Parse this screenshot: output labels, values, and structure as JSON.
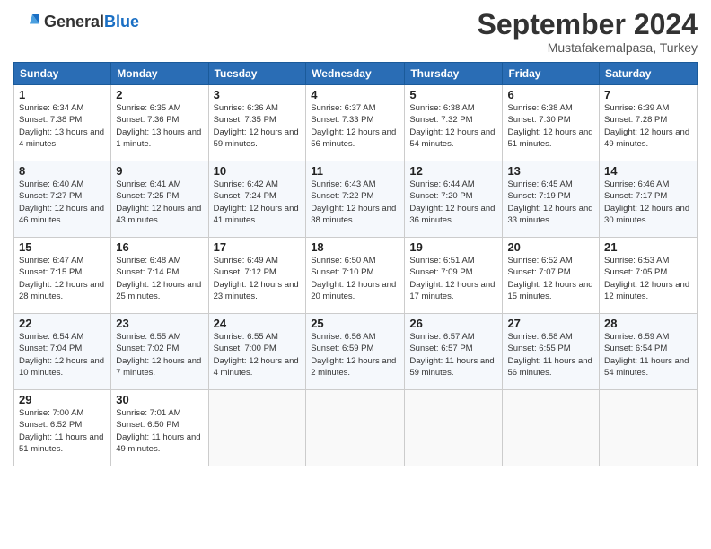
{
  "header": {
    "logo_general": "General",
    "logo_blue": "Blue",
    "month_title": "September 2024",
    "location": "Mustafakemalpasa, Turkey"
  },
  "weekdays": [
    "Sunday",
    "Monday",
    "Tuesday",
    "Wednesday",
    "Thursday",
    "Friday",
    "Saturday"
  ],
  "days": [
    {
      "day": "1",
      "sunrise": "6:34 AM",
      "sunset": "7:38 PM",
      "daylight": "13 hours and 4 minutes"
    },
    {
      "day": "2",
      "sunrise": "6:35 AM",
      "sunset": "7:36 PM",
      "daylight": "13 hours and 1 minute"
    },
    {
      "day": "3",
      "sunrise": "6:36 AM",
      "sunset": "7:35 PM",
      "daylight": "12 hours and 59 minutes"
    },
    {
      "day": "4",
      "sunrise": "6:37 AM",
      "sunset": "7:33 PM",
      "daylight": "12 hours and 56 minutes"
    },
    {
      "day": "5",
      "sunrise": "6:38 AM",
      "sunset": "7:32 PM",
      "daylight": "12 hours and 54 minutes"
    },
    {
      "day": "6",
      "sunrise": "6:38 AM",
      "sunset": "7:30 PM",
      "daylight": "12 hours and 51 minutes"
    },
    {
      "day": "7",
      "sunrise": "6:39 AM",
      "sunset": "7:28 PM",
      "daylight": "12 hours and 49 minutes"
    },
    {
      "day": "8",
      "sunrise": "6:40 AM",
      "sunset": "7:27 PM",
      "daylight": "12 hours and 46 minutes"
    },
    {
      "day": "9",
      "sunrise": "6:41 AM",
      "sunset": "7:25 PM",
      "daylight": "12 hours and 43 minutes"
    },
    {
      "day": "10",
      "sunrise": "6:42 AM",
      "sunset": "7:24 PM",
      "daylight": "12 hours and 41 minutes"
    },
    {
      "day": "11",
      "sunrise": "6:43 AM",
      "sunset": "7:22 PM",
      "daylight": "12 hours and 38 minutes"
    },
    {
      "day": "12",
      "sunrise": "6:44 AM",
      "sunset": "7:20 PM",
      "daylight": "12 hours and 36 minutes"
    },
    {
      "day": "13",
      "sunrise": "6:45 AM",
      "sunset": "7:19 PM",
      "daylight": "12 hours and 33 minutes"
    },
    {
      "day": "14",
      "sunrise": "6:46 AM",
      "sunset": "7:17 PM",
      "daylight": "12 hours and 30 minutes"
    },
    {
      "day": "15",
      "sunrise": "6:47 AM",
      "sunset": "7:15 PM",
      "daylight": "12 hours and 28 minutes"
    },
    {
      "day": "16",
      "sunrise": "6:48 AM",
      "sunset": "7:14 PM",
      "daylight": "12 hours and 25 minutes"
    },
    {
      "day": "17",
      "sunrise": "6:49 AM",
      "sunset": "7:12 PM",
      "daylight": "12 hours and 23 minutes"
    },
    {
      "day": "18",
      "sunrise": "6:50 AM",
      "sunset": "7:10 PM",
      "daylight": "12 hours and 20 minutes"
    },
    {
      "day": "19",
      "sunrise": "6:51 AM",
      "sunset": "7:09 PM",
      "daylight": "12 hours and 17 minutes"
    },
    {
      "day": "20",
      "sunrise": "6:52 AM",
      "sunset": "7:07 PM",
      "daylight": "12 hours and 15 minutes"
    },
    {
      "day": "21",
      "sunrise": "6:53 AM",
      "sunset": "7:05 PM",
      "daylight": "12 hours and 12 minutes"
    },
    {
      "day": "22",
      "sunrise": "6:54 AM",
      "sunset": "7:04 PM",
      "daylight": "12 hours and 10 minutes"
    },
    {
      "day": "23",
      "sunrise": "6:55 AM",
      "sunset": "7:02 PM",
      "daylight": "12 hours and 7 minutes"
    },
    {
      "day": "24",
      "sunrise": "6:55 AM",
      "sunset": "7:00 PM",
      "daylight": "12 hours and 4 minutes"
    },
    {
      "day": "25",
      "sunrise": "6:56 AM",
      "sunset": "6:59 PM",
      "daylight": "12 hours and 2 minutes"
    },
    {
      "day": "26",
      "sunrise": "6:57 AM",
      "sunset": "6:57 PM",
      "daylight": "11 hours and 59 minutes"
    },
    {
      "day": "27",
      "sunrise": "6:58 AM",
      "sunset": "6:55 PM",
      "daylight": "11 hours and 56 minutes"
    },
    {
      "day": "28",
      "sunrise": "6:59 AM",
      "sunset": "6:54 PM",
      "daylight": "11 hours and 54 minutes"
    },
    {
      "day": "29",
      "sunrise": "7:00 AM",
      "sunset": "6:52 PM",
      "daylight": "11 hours and 51 minutes"
    },
    {
      "day": "30",
      "sunrise": "7:01 AM",
      "sunset": "6:50 PM",
      "daylight": "11 hours and 49 minutes"
    }
  ]
}
